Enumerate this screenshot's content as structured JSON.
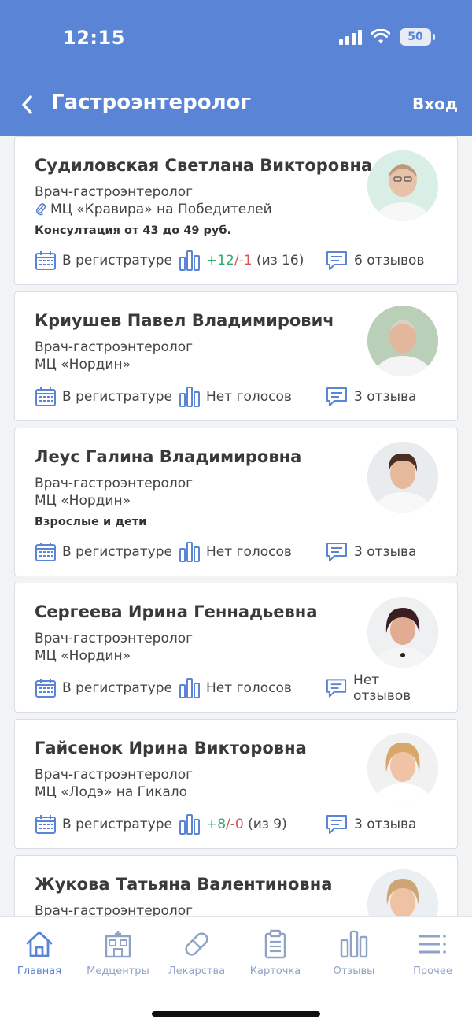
{
  "status": {
    "time": "12:15",
    "battery": "50"
  },
  "header": {
    "title": "Гастроэнтеролог",
    "login": "Вход"
  },
  "doctors": [
    {
      "name": "Судиловская Светлана Викторовна",
      "specialty": "Врач-гастроэнтеролог",
      "clinic": "МЦ «Кравира» на Победителей",
      "note": "Консултация от 43 до 49 руб.",
      "registration": "В регистратуре",
      "votes_pos": "+12",
      "votes_sep": "/",
      "votes_neg": "-1",
      "votes_total": " (из 16)",
      "reviews": "6 отзывов"
    },
    {
      "name": "Криушев Павел Владимирович",
      "specialty": "Врач-гастроэнтеролог",
      "clinic": "МЦ «Нордин»",
      "registration": "В регистратуре",
      "votes_text": "Нет голосов",
      "reviews": "3 отзыва"
    },
    {
      "name": "Леус Галина Владимировна",
      "specialty": "Врач-гастроэнтеролог",
      "clinic": "МЦ «Нордин»",
      "note": "Взрослые и дети",
      "registration": "В регистратуре",
      "votes_text": "Нет голосов",
      "reviews": "3 отзыва"
    },
    {
      "name": "Сергеева Ирина Геннадьевна",
      "specialty": "Врач-гастроэнтеролог",
      "clinic": "МЦ «Нордин»",
      "registration": "В регистратуре",
      "votes_text": "Нет голосов",
      "reviews": "Нет отзывов"
    },
    {
      "name": "Гайсенок Ирина Викторовна",
      "specialty": "Врач-гастроэнтеролог",
      "clinic": "МЦ «Лодэ» на Гикало",
      "registration": "В регистратуре",
      "votes_pos": "+8",
      "votes_sep": "/",
      "votes_neg": "-0",
      "votes_total": " (из 9)",
      "reviews": "3 отзыва"
    },
    {
      "name": "Жукова Татьяна Валентиновна",
      "specialty": "Врач-гастроэнтеролог"
    }
  ],
  "tabs": [
    {
      "label": "Главная",
      "icon": "home-icon"
    },
    {
      "label": "Медцентры",
      "icon": "hospital-icon"
    },
    {
      "label": "Лекарства",
      "icon": "pill-icon"
    },
    {
      "label": "Карточка",
      "icon": "clipboard-icon"
    },
    {
      "label": "Отзывы",
      "icon": "bar-chart-icon"
    },
    {
      "label": "Прочее",
      "icon": "more-icon"
    }
  ],
  "colors": {
    "header": "#5a84d6",
    "positive": "#2bab6c",
    "negative": "#d9534f",
    "tab_inactive": "#8fa3c7"
  }
}
